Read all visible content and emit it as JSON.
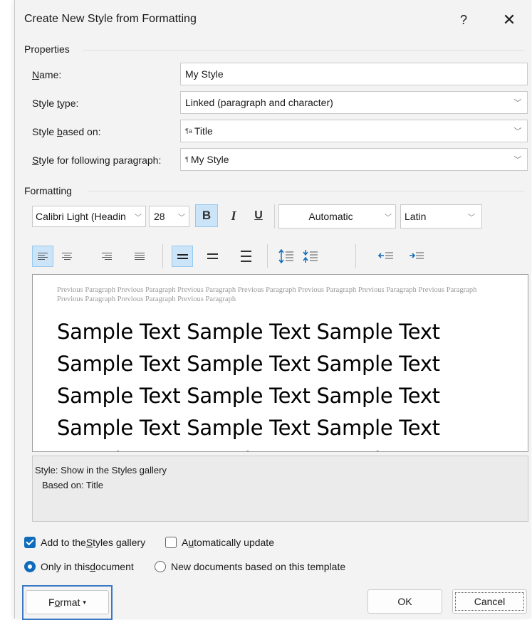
{
  "window": {
    "title": "Create New Style from Formatting",
    "help": "?",
    "close": "✕"
  },
  "properties": {
    "header": "Properties",
    "name_label_u": "N",
    "name_label_rest": "ame:",
    "name_value": "My Style",
    "type_label_pre": "Style ",
    "type_label_u": "t",
    "type_label_rest": "ype:",
    "type_value": "Linked (paragraph and character)",
    "based_label_pre": "Style ",
    "based_label_u": "b",
    "based_label_rest": "ased on:",
    "based_marker": "¶a",
    "based_value": "Title",
    "following_label_u": "S",
    "following_label_rest": "tyle for following paragraph:",
    "following_marker": "¶",
    "following_value": "My Style"
  },
  "formatting": {
    "header": "Formatting",
    "font": "Calibri Light (Headin",
    "size": "28",
    "bold": "B",
    "italic": "I",
    "underline": "U",
    "color": "Automatic",
    "script": "Latin",
    "bold_active": true,
    "active_alignment": "align-left",
    "active_spacing": "single"
  },
  "preview": {
    "previous_paragraph": "Previous Paragraph Previous Paragraph Previous Paragraph Previous Paragraph Previous Paragraph Previous Paragraph Previous Paragraph Previous Paragraph Previous Paragraph Previous Paragraph",
    "sample_lines": [
      "Sample Text Sample Text Sample Text",
      "Sample Text Sample Text Sample Text",
      "Sample Text Sample Text Sample Text",
      "Sample Text Sample Text Sample Text",
      "Sample Text Sample Text Sample Text"
    ]
  },
  "description": {
    "line1": "Style: Show in the Styles gallery",
    "line2": "Based on: Title"
  },
  "options": {
    "add_gallery_pre": "Add to the ",
    "add_gallery_u": "S",
    "add_gallery_rest": "tyles gallery",
    "add_gallery_checked": true,
    "auto_update_pre": "A",
    "auto_update_u": "u",
    "auto_update_rest": "tomatically update",
    "auto_update_checked": false,
    "only_doc_pre": "Only in this ",
    "only_doc_u": "d",
    "only_doc_rest": "ocument",
    "only_doc_selected": true,
    "new_docs_label": "New documents based on this template",
    "new_docs_selected": false
  },
  "buttons": {
    "format_pre": "F",
    "format_u": "o",
    "format_rest": "rmat",
    "format_arrow": "▾",
    "ok": "OK",
    "cancel": "Cancel"
  },
  "colors": {
    "accent": "#0f6cbd",
    "active_bg": "#cce4f7",
    "focus_border": "#3a78c5"
  }
}
